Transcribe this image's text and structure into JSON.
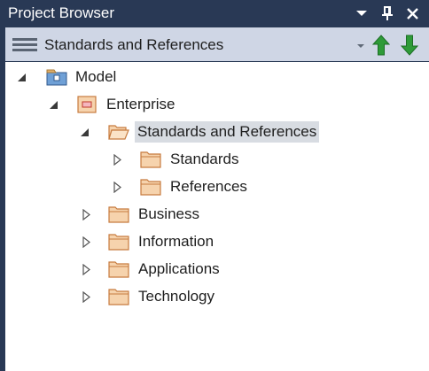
{
  "window": {
    "title": "Project Browser",
    "controls": [
      "chevron-down-icon",
      "pin-icon",
      "close-icon"
    ]
  },
  "toolbar": {
    "menu_icon": "hamburger-menu-icon",
    "current_package": "Standards and References",
    "actions": [
      "dropdown-icon",
      "move-up-icon",
      "move-down-icon"
    ]
  },
  "colors": {
    "title_bar": "#293955",
    "toolbar": "#cfd6e5",
    "selection": "#d8dce2",
    "folder_fill": "#f6d3ad",
    "folder_stroke": "#c77b3f",
    "arrow_green": "#2e9b38"
  },
  "tree": {
    "model": "Model",
    "enterprise": "Enterprise",
    "standards_and_references": "Standards and References",
    "standards": "Standards",
    "references": "References",
    "business": "Business",
    "information": "Information",
    "applications": "Applications",
    "technology": "Technology"
  }
}
